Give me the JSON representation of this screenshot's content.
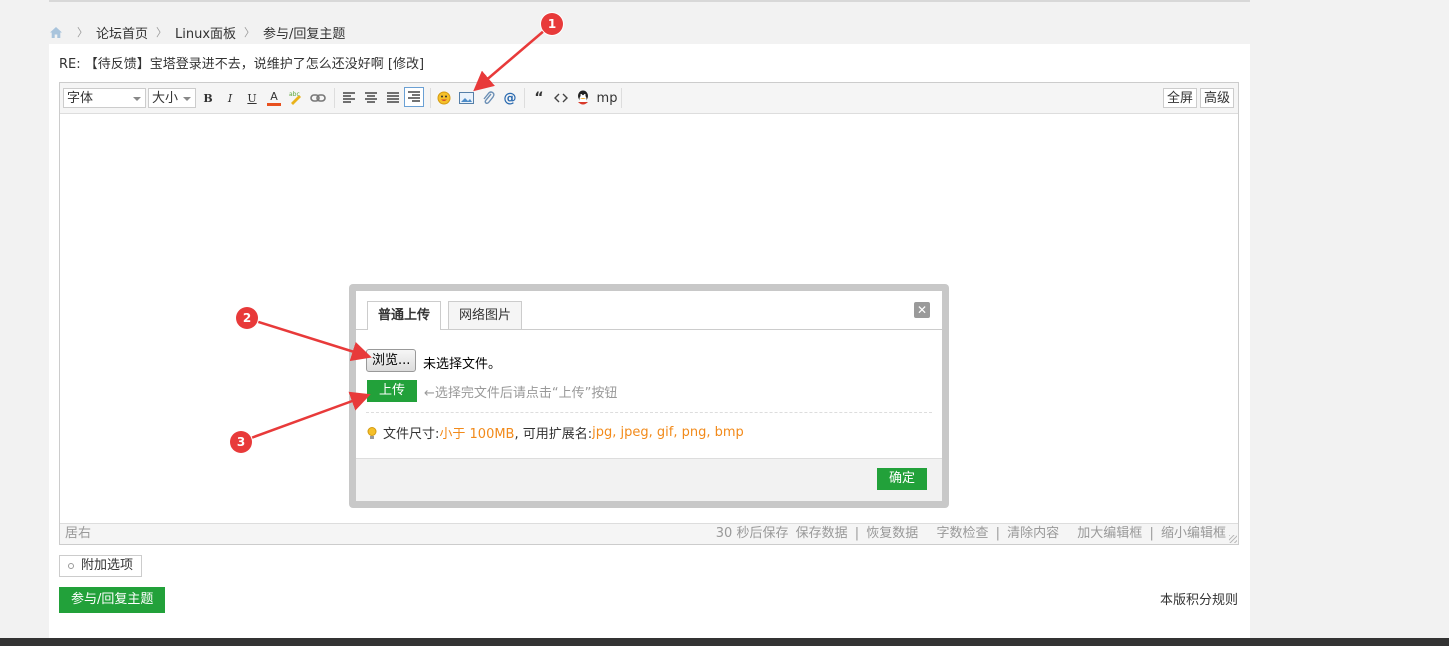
{
  "breadcrumb": {
    "items": [
      "论坛首页",
      "Linux面板",
      "参与/回复主题"
    ]
  },
  "subject": "RE: 【待反馈】宝塔登录进不去，说维护了怎么还没好啊 [修改]",
  "toolbar": {
    "font_select": "字体",
    "size_select": "大小",
    "bold": "B",
    "italic": "I",
    "underline": "U",
    "font_color": "A",
    "mp": "mp",
    "fullscreen": "全屏",
    "advanced": "高级"
  },
  "status": {
    "left": "居右",
    "autosave": "30 秒后保存",
    "save": "保存数据",
    "restore": "恢复数据",
    "wordcount": "字数检查",
    "clear": "清除内容",
    "enlarge": "加大编辑框",
    "shrink": "缩小编辑框",
    "separator": "|"
  },
  "dialog": {
    "tab_local": "普通上传",
    "tab_network": "网络图片",
    "close": "✕",
    "browse": "浏览...",
    "no_file": "未选择文件。",
    "upload": "上传",
    "upload_hint": "←选择完文件后请点击“上传”按钮",
    "size_label": "文件尺寸: ",
    "size_value": "小于 100MB",
    "ext_label": " , 可用扩展名: ",
    "ext_value": "jpg, jpeg, gif, png, bmp",
    "ok": "确定"
  },
  "attach_options": "附加选项",
  "reply_button": "参与/回复主题",
  "rules_link": "本版积分规则",
  "annotations": [
    "1",
    "2",
    "3"
  ],
  "colors": {
    "accent_green": "#22a13a",
    "highlight_orange": "#f28a1a",
    "annotation_red": "#e83a3a"
  }
}
